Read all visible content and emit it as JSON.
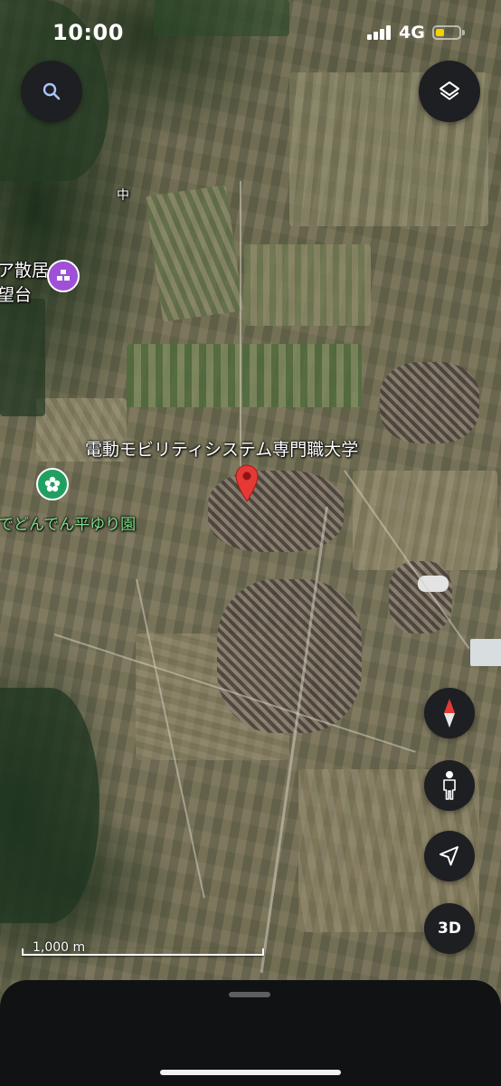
{
  "status_bar": {
    "time": "10:00",
    "network": "4G",
    "battery_color": "#f5d100"
  },
  "controls": {
    "search_icon": "search-icon",
    "layers_icon": "layers-icon",
    "compass_icon": "compass-icon",
    "street_view_icon": "pegman-icon",
    "my_location_icon": "navigation-arrow-icon",
    "three_d_label": "3D"
  },
  "map": {
    "place_labels": {
      "small_label": "中",
      "poi_1_line_1": "ア散居",
      "poi_1_line_2": "望台",
      "selected_place": "電動モビリティシステム専門職大学",
      "park": "でどんでん平ゆり園"
    },
    "poi_colors": {
      "viewpoint": "#a050d8",
      "garden": "#20a060",
      "pin": "#e53935"
    },
    "scale_label": "1,000 m"
  }
}
